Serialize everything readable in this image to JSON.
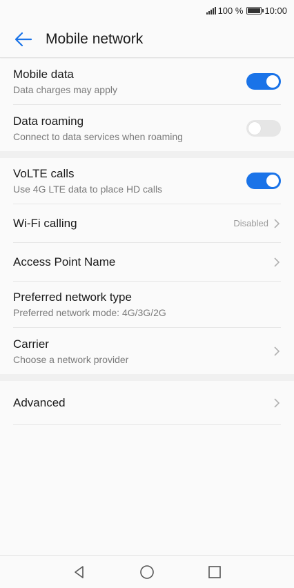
{
  "status_bar": {
    "battery_percent": "100 %",
    "time": "10:00",
    "battery_level": 1.0
  },
  "header": {
    "title": "Mobile network"
  },
  "groups": [
    {
      "items": [
        {
          "label": "Mobile data",
          "subtitle": "Data charges may apply",
          "toggle": true
        },
        {
          "label": "Data roaming",
          "subtitle": "Connect to data services when roaming",
          "toggle": false
        }
      ]
    },
    {
      "items": [
        {
          "label": "VoLTE calls",
          "subtitle": "Use 4G LTE data to place HD calls",
          "toggle": true
        },
        {
          "label": "Wi-Fi calling",
          "value": "Disabled"
        },
        {
          "label": "Access Point Name"
        },
        {
          "label": "Preferred network type",
          "subtitle": "Preferred network mode: 4G/3G/2G"
        },
        {
          "label": "Carrier",
          "subtitle": "Choose a network provider"
        }
      ]
    },
    {
      "items": [
        {
          "label": "Advanced"
        }
      ]
    }
  ],
  "colors": {
    "accent": "#1a73e8",
    "toggle_off": "#e6e6e6",
    "divider": "#e6e6e6"
  },
  "icons": {
    "back": "arrow-left-icon",
    "chevron": "chevron-right-icon",
    "nav_back": "triangle-back-icon",
    "nav_home": "circle-home-icon",
    "nav_recent": "square-recent-icon"
  }
}
